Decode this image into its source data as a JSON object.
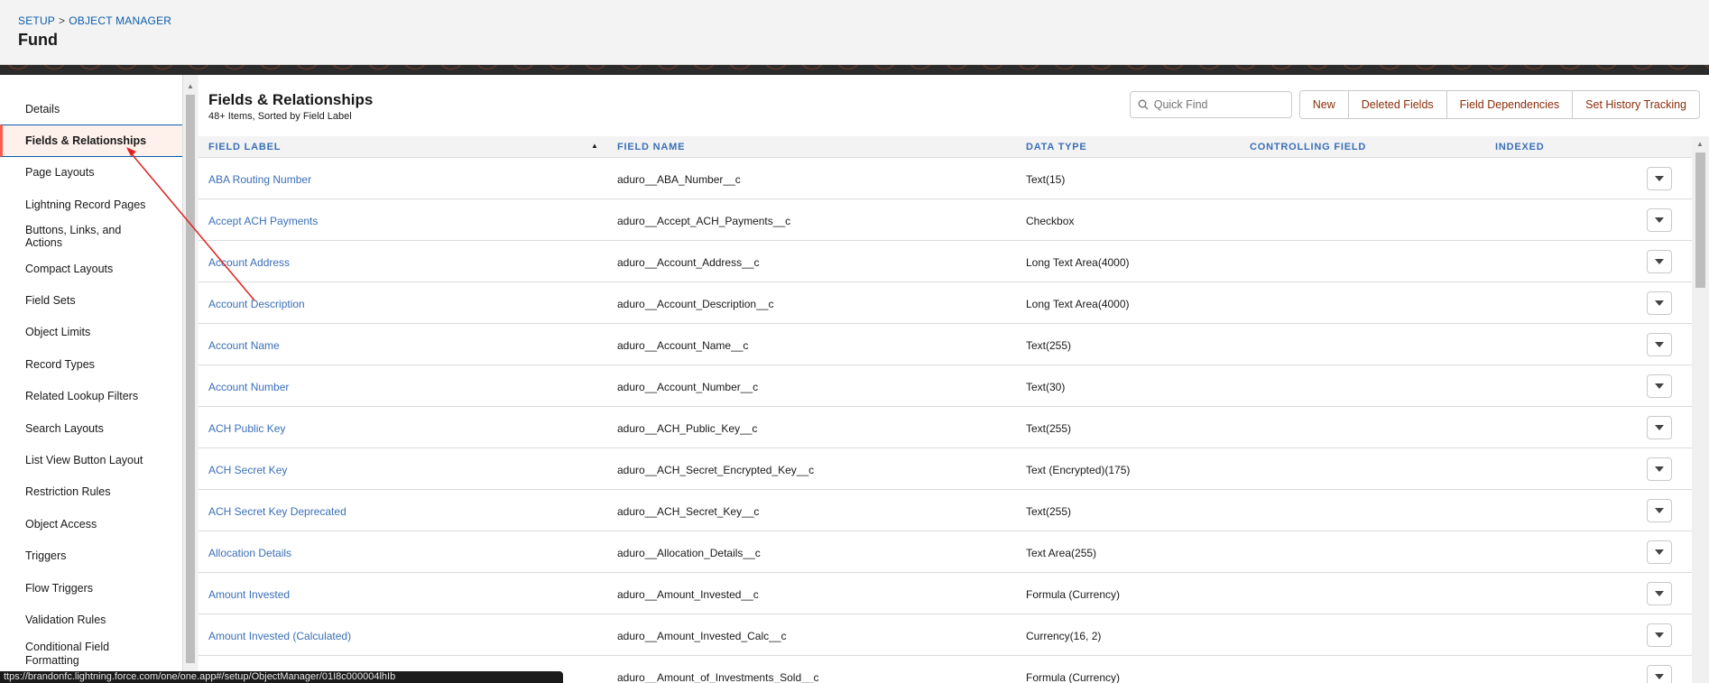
{
  "header": {
    "breadcrumb": [
      "SETUP",
      "OBJECT MANAGER"
    ],
    "breadcrumb_sep": ">",
    "title": "Fund"
  },
  "sidebar": {
    "items": [
      {
        "label": "Details",
        "active": false
      },
      {
        "label": "Fields & Relationships",
        "active": true
      },
      {
        "label": "Page Layouts",
        "active": false
      },
      {
        "label": "Lightning Record Pages",
        "active": false
      },
      {
        "label": "Buttons, Links, and Actions",
        "active": false
      },
      {
        "label": "Compact Layouts",
        "active": false
      },
      {
        "label": "Field Sets",
        "active": false
      },
      {
        "label": "Object Limits",
        "active": false
      },
      {
        "label": "Record Types",
        "active": false
      },
      {
        "label": "Related Lookup Filters",
        "active": false
      },
      {
        "label": "Search Layouts",
        "active": false
      },
      {
        "label": "List View Button Layout",
        "active": false
      },
      {
        "label": "Restriction Rules",
        "active": false
      },
      {
        "label": "Object Access",
        "active": false
      },
      {
        "label": "Triggers",
        "active": false
      },
      {
        "label": "Flow Triggers",
        "active": false
      },
      {
        "label": "Validation Rules",
        "active": false
      },
      {
        "label": "Conditional Field Formatting",
        "active": false
      }
    ]
  },
  "main": {
    "title": "Fields & Relationships",
    "subtitle": "48+ Items, Sorted by Field Label",
    "quick_find_placeholder": "Quick Find",
    "buttons": [
      "New",
      "Deleted Fields",
      "Field Dependencies",
      "Set History Tracking"
    ],
    "columns": [
      "FIELD LABEL",
      "FIELD NAME",
      "DATA TYPE",
      "CONTROLLING FIELD",
      "INDEXED"
    ],
    "rows": [
      {
        "label": "ABA Routing Number",
        "name": "aduro__ABA_Number__c",
        "type": "Text(15)"
      },
      {
        "label": "Accept ACH Payments",
        "name": "aduro__Accept_ACH_Payments__c",
        "type": "Checkbox"
      },
      {
        "label": "Account Address",
        "name": "aduro__Account_Address__c",
        "type": "Long Text Area(4000)"
      },
      {
        "label": "Account Description",
        "name": "aduro__Account_Description__c",
        "type": "Long Text Area(4000)"
      },
      {
        "label": "Account Name",
        "name": "aduro__Account_Name__c",
        "type": "Text(255)"
      },
      {
        "label": "Account Number",
        "name": "aduro__Account_Number__c",
        "type": "Text(30)"
      },
      {
        "label": "ACH Public Key",
        "name": "aduro__ACH_Public_Key__c",
        "type": "Text(255)"
      },
      {
        "label": "ACH Secret Key",
        "name": "aduro__ACH_Secret_Encrypted_Key__c",
        "type": "Text (Encrypted)(175)"
      },
      {
        "label": "ACH Secret Key Deprecated",
        "name": "aduro__ACH_Secret_Key__c",
        "type": "Text(255)"
      },
      {
        "label": "Allocation Details",
        "name": "aduro__Allocation_Details__c",
        "type": "Text Area(255)"
      },
      {
        "label": "Amount Invested",
        "name": "aduro__Amount_Invested__c",
        "type": "Formula (Currency)"
      },
      {
        "label": "Amount Invested (Calculated)",
        "name": "aduro__Amount_Invested_Calc__c",
        "type": "Currency(16, 2)"
      },
      {
        "label": "",
        "name": "aduro__Amount_of_Investments_Sold__c",
        "type": "Formula (Currency)"
      }
    ]
  },
  "status_url": "ttps://brandonfc.lightning.force.com/one/one.app#/setup/ObjectManager/01I8c000004lhIb",
  "colors": {
    "link_blue": "#3a6fb8",
    "button_text": "#8b2e0a",
    "active_accent": "#fe5c4c",
    "annotation_red": "#e02020"
  }
}
